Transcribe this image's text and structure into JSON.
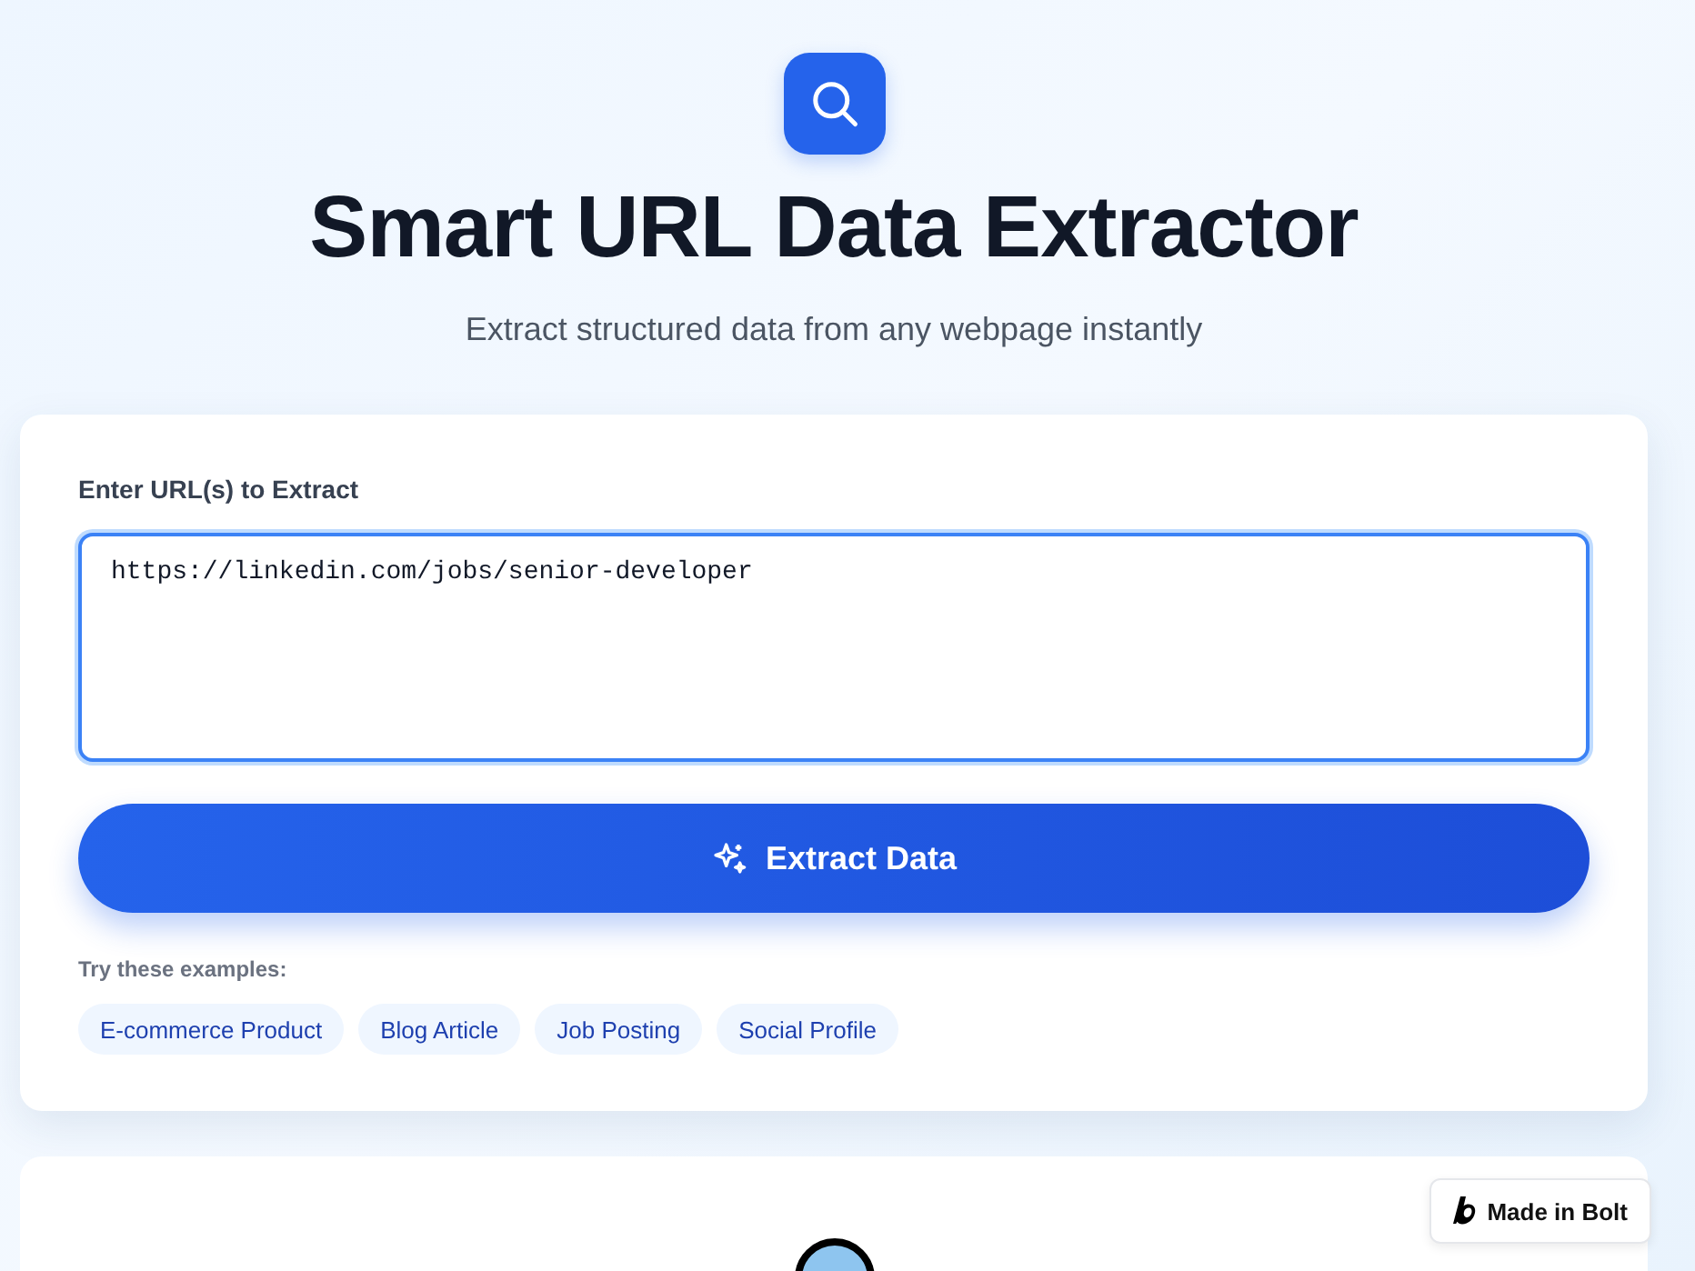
{
  "header": {
    "title": "Smart URL Data Extractor",
    "subtitle": "Extract structured data from any webpage instantly"
  },
  "form": {
    "label": "Enter URL(s) to Extract",
    "value": "https://linkedin.com/jobs/senior-developer",
    "button": "Extract Data",
    "examples_label": "Try these examples:",
    "examples": [
      {
        "label": "E-commerce Product"
      },
      {
        "label": "Blog Article"
      },
      {
        "label": "Job Posting"
      },
      {
        "label": "Social Profile"
      }
    ]
  },
  "badge": {
    "label": "Made in Bolt"
  }
}
